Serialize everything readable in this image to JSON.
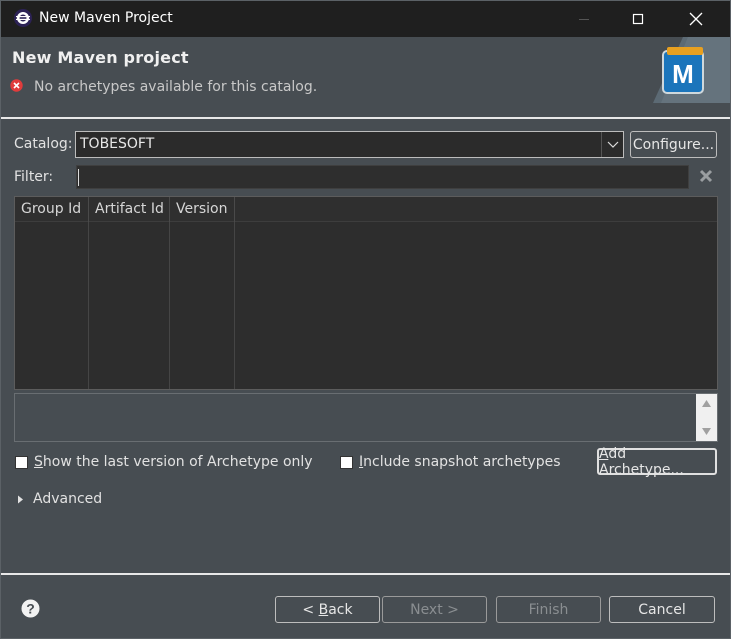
{
  "window": {
    "title": "New Maven Project"
  },
  "banner": {
    "heading": "New Maven project",
    "message": "No archetypes available for this catalog.",
    "logo_letter": "M"
  },
  "catalog": {
    "label": "Catalog:",
    "value": "TOBESOFT",
    "configure_label": "Configure..."
  },
  "filter": {
    "label": "Filter:",
    "value": ""
  },
  "table": {
    "columns": [
      "Group Id",
      "Artifact Id",
      "Version"
    ],
    "rows": []
  },
  "options": {
    "show_last_version_label": "Show the last version of Archetype only",
    "show_last_version_checked": false,
    "include_snapshot_label": "Include snapshot archetypes",
    "include_snapshot_checked": false,
    "add_archetype_label": "Add Archetype..."
  },
  "advanced": {
    "label": "Advanced"
  },
  "footer": {
    "back_label": "< Back",
    "next_label": "Next >",
    "finish_label": "Finish",
    "cancel_label": "Cancel"
  },
  "colors": {
    "window_bg": "#474d52",
    "titlebar_bg": "#1f1f1f",
    "error_red": "#e03c3c",
    "maven_blue": "#1b75bb"
  },
  "icons": [
    "app-icon",
    "minimize-icon",
    "maximize-icon",
    "close-icon",
    "error-icon",
    "maven-logo",
    "chevron-down-icon",
    "clear-icon",
    "scroll-up-icon",
    "scroll-down-icon",
    "chevron-right-icon",
    "help-icon"
  ]
}
